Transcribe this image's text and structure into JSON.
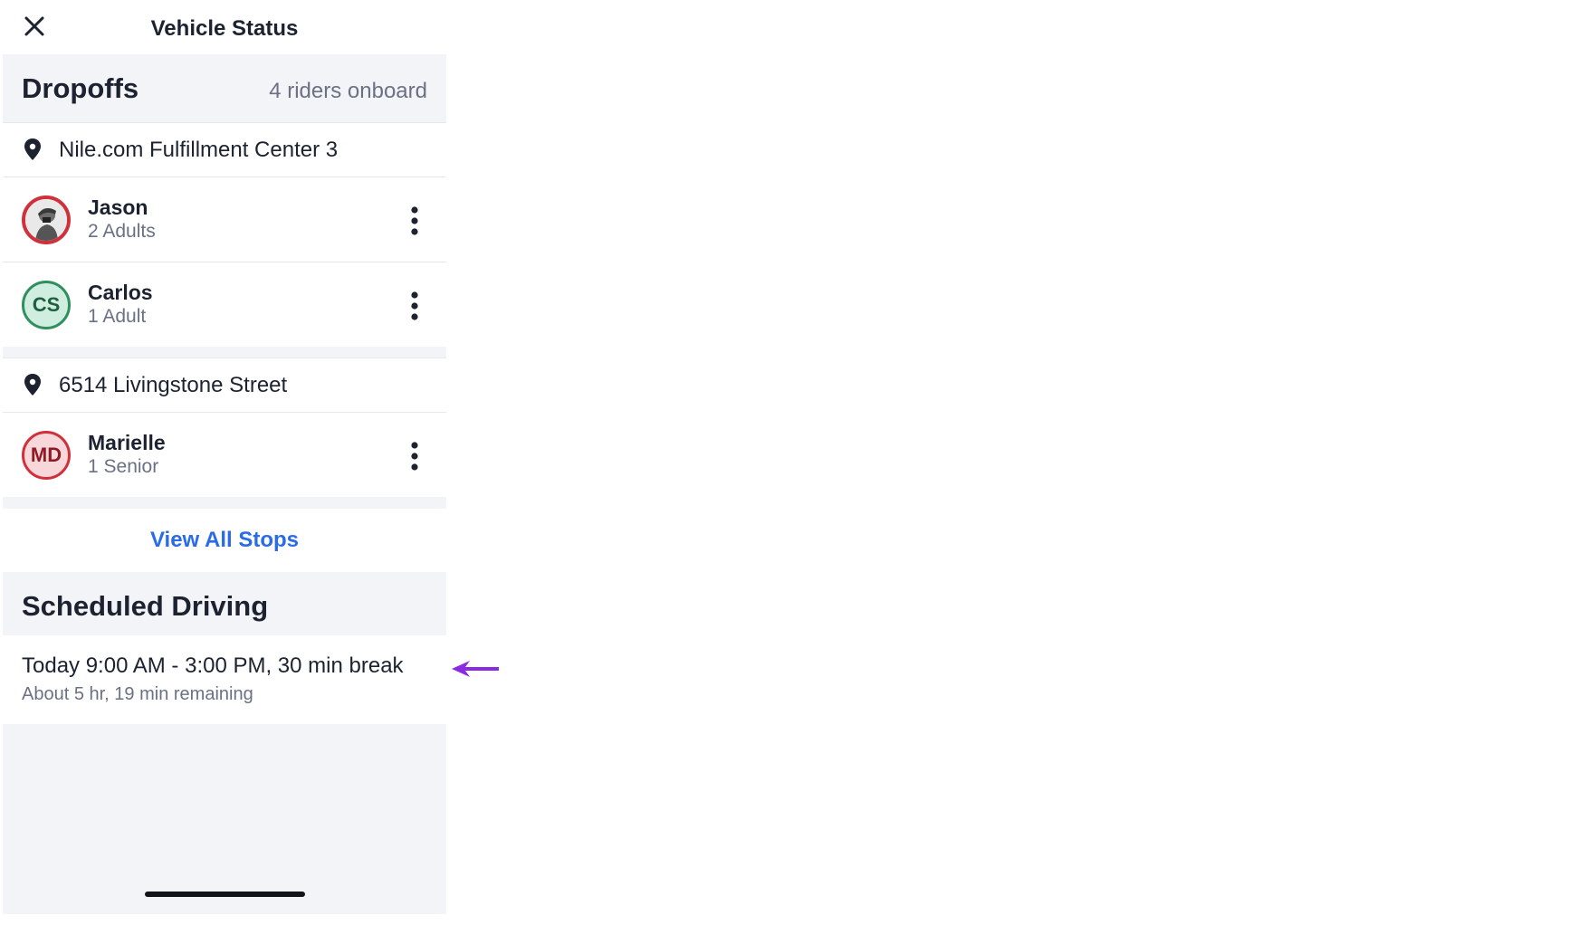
{
  "header": {
    "title": "Vehicle Status"
  },
  "dropoffs": {
    "title": "Dropoffs",
    "riders_onboard": "4 riders onboard",
    "stops": [
      {
        "address": "Nile.com Fulfillment Center 3",
        "riders": [
          {
            "name": "Jason",
            "detail": "2 Adults",
            "avatar_type": "photo",
            "initials": "",
            "avatar_color": "#d12f3a"
          },
          {
            "name": "Carlos",
            "detail": "1 Adult",
            "avatar_type": "initials",
            "initials": "CS",
            "avatar_color": "#2f8f5d"
          }
        ]
      },
      {
        "address": "6514 Livingstone Street",
        "riders": [
          {
            "name": "Marielle",
            "detail": "1 Senior",
            "avatar_type": "initials",
            "initials": "MD",
            "avatar_color": "#d12f3a"
          }
        ]
      }
    ],
    "view_all_label": "View All Stops"
  },
  "scheduled_driving": {
    "title": "Scheduled Driving",
    "schedule": "Today 9:00 AM - 3:00 PM, 30 min break",
    "remaining": "About 5 hr, 19 min remaining"
  },
  "annotation": {
    "arrow_color": "#8a2be2",
    "direction": "left"
  },
  "colors": {
    "accent": "#2a6be8",
    "text_primary": "#1c2230",
    "text_secondary": "#6b7185",
    "section_bg": "#f3f4f7"
  },
  "icons": {
    "close": "close-icon",
    "pin": "location-pin-icon",
    "more": "more-vertical-icon"
  }
}
